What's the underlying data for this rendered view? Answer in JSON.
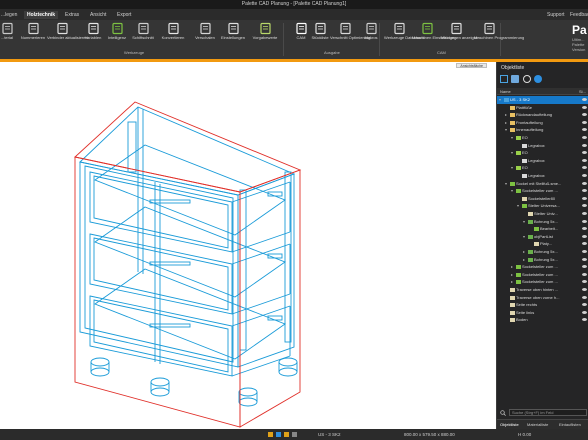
{
  "window": {
    "title": "Palette CAD Planung - [Palette CAD Planung1]"
  },
  "menu": {
    "tabs": [
      "...legen",
      "Holztechnik",
      "Extras",
      "Ansicht",
      "Export"
    ],
    "active_index": 1,
    "right": [
      "Support",
      "Feedback"
    ]
  },
  "ribbon": {
    "buttons": [
      {
        "label": "...terial",
        "icon": "material-icon"
      },
      {
        "label": "Nummerieren",
        "icon": "numbering-icon"
      },
      {
        "label": "Verbinder aktualisieren",
        "icon": "connector-icon"
      },
      {
        "label": "Variablen",
        "icon": "variables-icon"
      },
      {
        "label": "Intelligenz",
        "icon": "intelligence-icon"
      },
      {
        "label": "Schiftschnitt",
        "icon": "miter-cut-icon"
      },
      {
        "label": "Konvertieren",
        "icon": "convert-icon"
      },
      {
        "label": "Verschalen",
        "icon": "cladding-icon"
      },
      {
        "label": "Einstellungen",
        "icon": "settings-icon"
      },
      {
        "label": "Vorgabewerte",
        "icon": "defaults-icon"
      },
      {
        "label": "CAM",
        "icon": "cam-icon"
      },
      {
        "label": "Stückliste",
        "icon": "parts-list-icon"
      },
      {
        "label": "Verschnitt Optimierung",
        "icon": "cut-optimization-icon"
      },
      {
        "label": "Makros",
        "icon": "macros-icon"
      },
      {
        "label": "Werkzeuge Datenbank",
        "icon": "tool-database-icon"
      },
      {
        "label": "Maschinen Einstellungen",
        "icon": "machine-settings-icon"
      },
      {
        "label": "Meldungen anzeigen",
        "icon": "messages-icon"
      },
      {
        "label": "Maschinen Programmierung",
        "icon": "machine-programming-icon"
      }
    ],
    "groups": [
      "Werkzeuge",
      "Ausgabe",
      "CAM"
    ],
    "brand": "Pa",
    "brand_sub": [
      "Ultim...",
      "Palette",
      "Version"
    ]
  },
  "viewport": {
    "tag": "Ansichtsfläche"
  },
  "panel": {
    "title": "Objektliste",
    "columns": [
      "Name",
      "Si..."
    ],
    "tree": [
      {
        "label": "US - 3 SK2",
        "depth": 0,
        "icon": "cabinet",
        "arrow": "open",
        "selected": true
      },
      {
        "label": "Plattfüße",
        "depth": 1,
        "icon": "folder",
        "arrow": ""
      },
      {
        "label": "Rückwandaufteilung",
        "depth": 1,
        "icon": "folder",
        "arrow": "closed"
      },
      {
        "label": "Frontaufteilung",
        "depth": 1,
        "icon": "folder",
        "arrow": "closed"
      },
      {
        "label": "Innenaufteilung",
        "depth": 1,
        "icon": "folder",
        "arrow": "open"
      },
      {
        "label": "EO",
        "depth": 2,
        "icon": "grid",
        "arrow": "open"
      },
      {
        "label": "Legrabox",
        "depth": 3,
        "icon": "drawer",
        "arrow": ""
      },
      {
        "label": "EO",
        "depth": 2,
        "icon": "grid",
        "arrow": "open"
      },
      {
        "label": "Legrabox",
        "depth": 3,
        "icon": "drawer",
        "arrow": ""
      },
      {
        "label": "EO",
        "depth": 2,
        "icon": "grid",
        "arrow": "open"
      },
      {
        "label": "Legrabox",
        "depth": 3,
        "icon": "drawer",
        "arrow": ""
      },
      {
        "label": "Sockel mit Stellfuß-sme...",
        "depth": 1,
        "icon": "part",
        "arrow": "open"
      },
      {
        "label": "Sockelsteller zum ...",
        "depth": 2,
        "icon": "part",
        "arrow": "open"
      },
      {
        "label": "Sockelsteller80",
        "depth": 3,
        "icon": "board",
        "arrow": ""
      },
      {
        "label": "Stelter Universa...",
        "depth": 3,
        "icon": "part",
        "arrow": "open"
      },
      {
        "label": "Stelter Univ...",
        "depth": 4,
        "icon": "board",
        "arrow": ""
      },
      {
        "label": "Bohrung 5x...",
        "depth": 4,
        "icon": "drill",
        "arrow": "open"
      },
      {
        "label": "Bearbeit...",
        "depth": 5,
        "icon": "part",
        "arrow": ""
      },
      {
        "label": "objPartList",
        "depth": 4,
        "icon": "drill",
        "arrow": "open"
      },
      {
        "label": "Platy...",
        "depth": 5,
        "icon": "board",
        "arrow": ""
      },
      {
        "label": "Bohrung 5x...",
        "depth": 4,
        "icon": "drill",
        "arrow": "closed"
      },
      {
        "label": "Bohrung 5x...",
        "depth": 4,
        "icon": "drill",
        "arrow": "closed"
      },
      {
        "label": "Sockelsteller zum ...",
        "depth": 2,
        "icon": "part",
        "arrow": "closed"
      },
      {
        "label": "Sockelsteller zum ...",
        "depth": 2,
        "icon": "part",
        "arrow": "closed"
      },
      {
        "label": "Sockelsteller zum ...",
        "depth": 2,
        "icon": "part",
        "arrow": "closed"
      },
      {
        "label": "Traverse oben hinten ...",
        "depth": 1,
        "icon": "board",
        "arrow": ""
      },
      {
        "label": "Traverse oben vorne h...",
        "depth": 1,
        "icon": "board",
        "arrow": ""
      },
      {
        "label": "Seite rechts",
        "depth": 1,
        "icon": "board",
        "arrow": ""
      },
      {
        "label": "Seite links",
        "depth": 1,
        "icon": "board",
        "arrow": ""
      },
      {
        "label": "Boden",
        "depth": 1,
        "icon": "board",
        "arrow": ""
      }
    ],
    "search_placeholder": "Suche (Strg+F) im Feld",
    "tabs": [
      "Objektliste",
      "Materialliste",
      "Eintauflisten"
    ]
  },
  "status": {
    "object": "US - 3 SK2",
    "dimensions": "800.00 x 579.50 x 880.00",
    "height": "H 0.00"
  },
  "colors": {
    "accent": "#f29a10",
    "selection": "#1679c9",
    "cabinet_lines": "#1a9bd8",
    "bbox": "#e0302a"
  }
}
